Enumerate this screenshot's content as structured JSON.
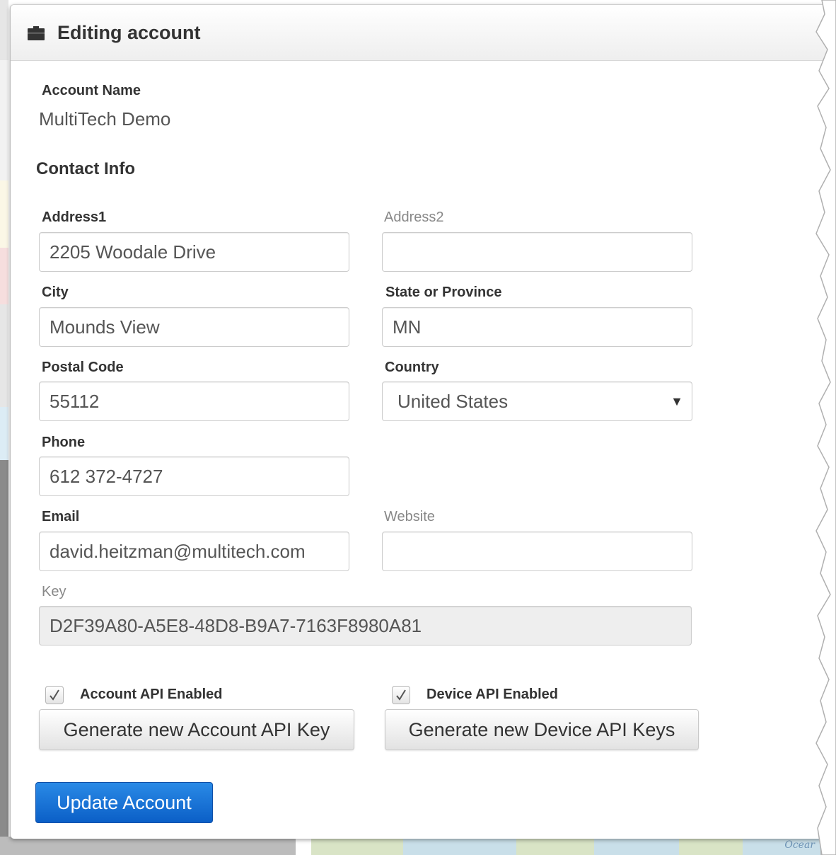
{
  "modal": {
    "title": "Editing account",
    "icon": "briefcase-icon"
  },
  "account": {
    "name_label": "Account Name",
    "name_value": "MultiTech Demo"
  },
  "contact": {
    "section_title": "Contact Info",
    "address1": {
      "label": "Address1",
      "value": "2205 Woodale Drive"
    },
    "address2": {
      "label": "Address2",
      "value": ""
    },
    "city": {
      "label": "City",
      "value": "Mounds View"
    },
    "state": {
      "label": "State or Province",
      "value": "MN"
    },
    "postal": {
      "label": "Postal Code",
      "value": "55112"
    },
    "country": {
      "label": "Country",
      "value": "United States"
    },
    "phone": {
      "label": "Phone",
      "value": "612 372-4727"
    },
    "email": {
      "label": "Email",
      "value": "david.heitzman@multitech.com"
    },
    "website": {
      "label": "Website",
      "value": ""
    },
    "key": {
      "label": "Key",
      "value": "D2F39A80-A5E8-48D8-B9A7-7163F8980A81"
    }
  },
  "api": {
    "account_enabled_label": "Account API Enabled",
    "account_enabled": true,
    "device_enabled_label": "Device API Enabled",
    "device_enabled": true,
    "generate_account_label": "Generate new Account API Key",
    "generate_device_label": "Generate new Device API Keys"
  },
  "actions": {
    "update_label": "Update Account"
  },
  "background": {
    "map_label": "Ocear"
  },
  "colors": {
    "primary": "#0b5fc7",
    "readonly_bg": "#eeeeee"
  }
}
